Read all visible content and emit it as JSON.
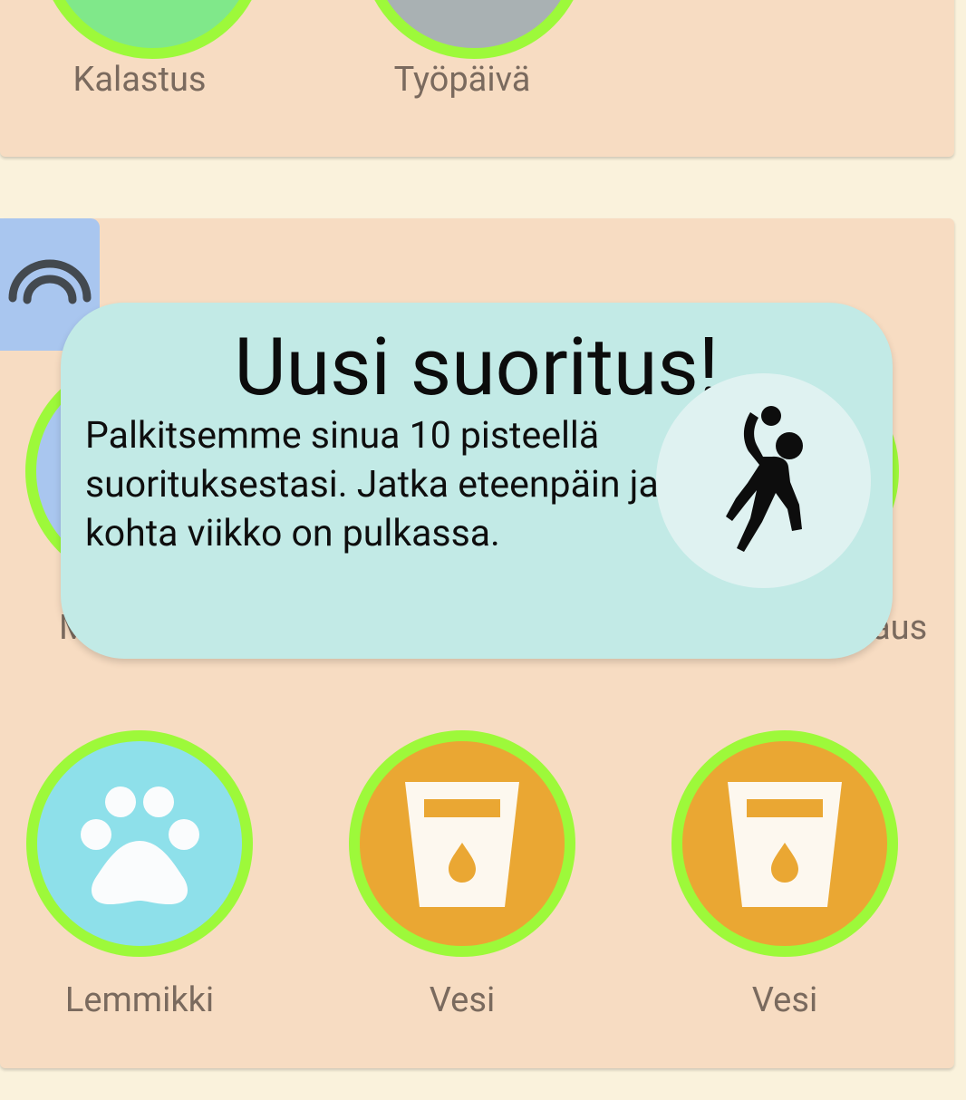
{
  "top_card": {
    "items": [
      {
        "label": "Kalastus",
        "color": "#80e88a"
      },
      {
        "label": "Työpäivä",
        "color": "#a9b1b3"
      }
    ]
  },
  "main_card": {
    "row1_partial": [
      {
        "label_fragment": "M"
      },
      {
        "label_fragment": "rjaus"
      }
    ],
    "items": [
      {
        "label": "Lemmikki",
        "icon": "paw-icon",
        "color": "#8ee0ea"
      },
      {
        "label": "Vesi",
        "icon": "water-glass-icon",
        "color": "#eaa733"
      },
      {
        "label": "Vesi",
        "icon": "water-glass-icon",
        "color": "#eaa733"
      }
    ]
  },
  "popup": {
    "title": "Uusi suoritus!",
    "body": "Palkitsemme sinua 10 pisteellä suorituksestasi. Jatka eteenpäin ja kohta viikko on pulkassa.",
    "icon": "handball-icon"
  },
  "side_tab": {
    "icon": "rainbow-icon"
  },
  "colors": {
    "background": "#faf2dc",
    "card": "#f7dcc2",
    "ring": "#9df93a",
    "popup": "#c2eae6",
    "label": "#7a6a5e"
  }
}
